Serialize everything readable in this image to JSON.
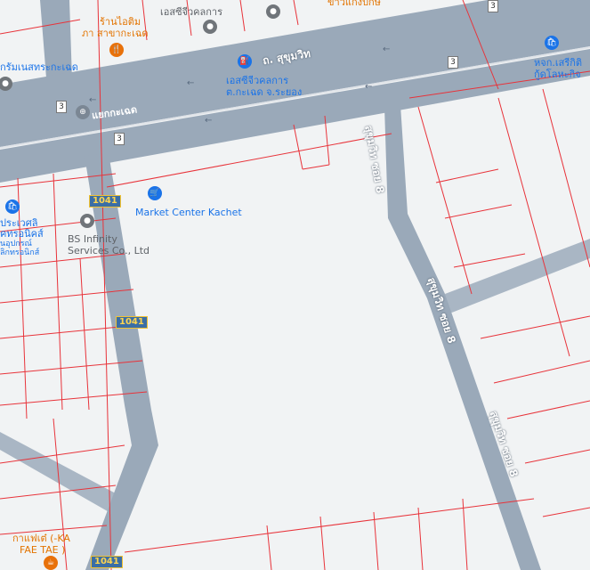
{
  "map": {
    "colors": {
      "background": "#f1f3f4",
      "road": "#9aa9b9",
      "road_edge": "#8495a8",
      "parcel_line": "#e8333a",
      "poi_blue": "#1a73e8",
      "poi_orange": "#e8710a",
      "poi_gray": "#70757a"
    },
    "roads": {
      "main": "ถ. สุขุมวิท",
      "soi_upper": "สุขุมวิท ซอย 8",
      "soi_middle": "สุขุมวิท ซอย 8",
      "soi_lower": "สุขุมวิท ซอย 8",
      "intersection": "แยกกะเฉด"
    },
    "route_shields": {
      "r1041_top": "1041",
      "r1041_mid": "1041",
      "r1041_bottom": "1041",
      "r3_a": "3",
      "r3_b": "3",
      "r3_c": "3",
      "r3_d": "3"
    },
    "pois": {
      "market_center": "Market Center Kachet",
      "bs_infinity_1": "BS Infinity",
      "bs_infinity_2": "Services Co., Ltd",
      "fuel_station_1": "เอสซีจีวคลการ",
      "fuel_station_2": "ต.กะเฉด จ.ระยอง",
      "top_poi": "เอสซีจีวคลการ",
      "shop_top_1": "ร้านไอติม",
      "shop_top_2": "ภา สาขากะเฉด",
      "left_poi": "กรัมเนสทระกะเฉด",
      "top_right_1": "หจก.เสรีกิติ",
      "top_right_2": "กู้ดโลหะกิจ",
      "left_blue_1": "ประเวศลิ",
      "left_blue_2": "คทรอนิคส์",
      "left_blue_3": "นอุปกรณ์",
      "left_blue_4": "ลิกทรอนิกส์",
      "cafe_1": "กาแฟเต๋ (-KA",
      "cafe_2": "FAE TAE )",
      "top_orange": "ข้าวแกงปักษ์"
    },
    "icons": {
      "market": "shopping-cart-icon",
      "gas": "gas-station-icon",
      "restaurant": "restaurant-icon",
      "place": "place-pin-icon",
      "shop": "shopping-bag-icon",
      "coffee": "coffee-icon",
      "junction": "junction-icon"
    }
  }
}
